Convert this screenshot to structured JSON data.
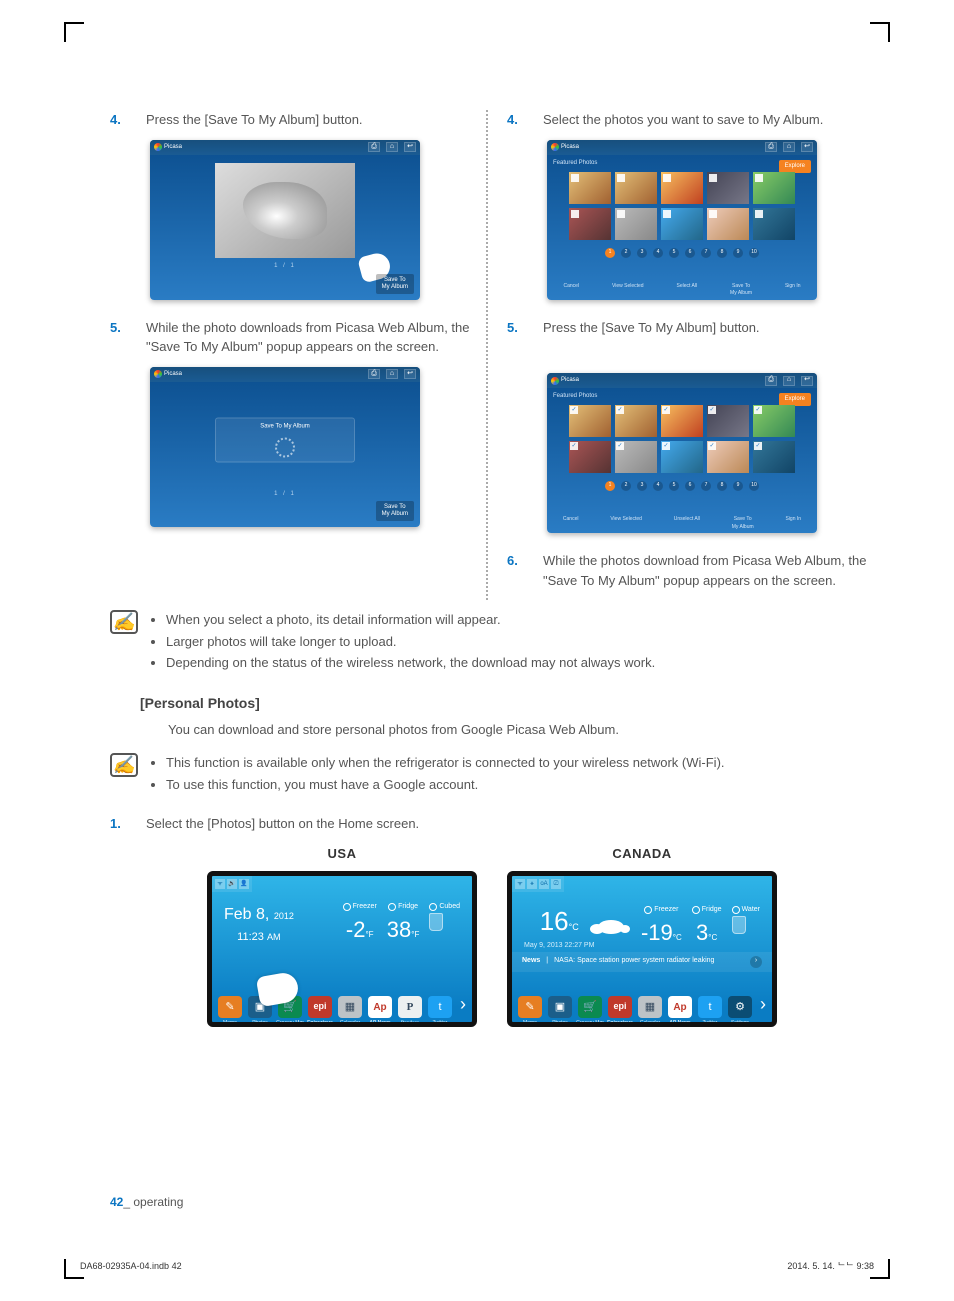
{
  "left": {
    "steps": [
      {
        "num": "4.",
        "text": "Press the [Save To My Album] button."
      },
      {
        "num": "5.",
        "text": "While the photo downloads from Picasa Web Album, the \"Save To My Album\" popup appears on the screen."
      }
    ]
  },
  "right": {
    "steps": [
      {
        "num": "4.",
        "text": "Select the photos you want to save to My Album."
      },
      {
        "num": "5.",
        "text": "Press the [Save To My Album] button."
      },
      {
        "num": "6.",
        "text": "While the photos download from Picasa Web Album, the \"Save To My Album\" popup appears on the screen."
      }
    ]
  },
  "ss": {
    "app_name": "Picasa",
    "count_label": "1 / 1",
    "save_btn": "Save To\nMy Album",
    "popup_text": "Save To My Album",
    "featured": "Featured Photos",
    "explore": "Explore",
    "bottom1": [
      "Cancel",
      "View Selected",
      "Select All",
      "Save To\nMy Album",
      "Sign In"
    ],
    "bottom2": [
      "Cancel",
      "View Selected",
      "Unselect All",
      "Save To\nMy Album",
      "Sign In"
    ],
    "pages": [
      "1",
      "2",
      "3",
      "4",
      "5",
      "6",
      "7",
      "8",
      "9",
      "10"
    ]
  },
  "notes1": [
    "When you select a photo, its detail information will appear.",
    "Larger photos will take longer to upload.",
    "Depending on the status of the wireless network, the download may not always work."
  ],
  "personal": {
    "title": "[Personal Photos]",
    "desc": "You can download and store personal photos from Google Picasa Web Album."
  },
  "notes2": [
    "This function is available only when the refrigerator is connected to your wireless network (Wi-Fi).",
    "To use this function, you must have a Google account."
  ],
  "step1": {
    "num": "1.",
    "text": "Select the [Photos] button on the Home screen."
  },
  "devices": {
    "usa": {
      "label": "USA",
      "date_month": "Feb 8,",
      "date_year": "2012",
      "time_val": "11:23",
      "time_ampm": "AM",
      "freezer_label": "Freezer",
      "freezer_val": "-2",
      "freezer_unit": "°F",
      "fridge_label": "Fridge",
      "fridge_val": "38",
      "fridge_unit": "°F",
      "cubed_label": "Cubed",
      "dock": [
        "Memo",
        "Photos",
        "Grocery Mgr",
        "Epicurious",
        "Calendar",
        "AP News",
        "Pandora",
        "Twitter"
      ]
    },
    "canada": {
      "label": "CANADA",
      "temp_val": "16",
      "temp_unit": "°C",
      "sub_date": "May 9, 2013 22:27 PM",
      "freezer_label": "Freezer",
      "freezer_val": "-19",
      "freezer_unit": "°C",
      "fridge_label": "Fridge",
      "fridge_val": "3",
      "fridge_unit": "°C",
      "water_label": "Water",
      "news_label": "News",
      "news_text": "NASA: Space station power system radiator leaking",
      "dock": [
        "Memo",
        "Photos",
        "Grocery Mgr",
        "Epicurious",
        "Calendar",
        "AP News",
        "Twitter",
        "Settings"
      ]
    }
  },
  "footer": {
    "page": "42",
    "section": "_ operating"
  },
  "print": {
    "left": "DA68-02935A-04.indb   42",
    "right": "2014. 5. 14.   ᄂᄂ 9:38"
  }
}
